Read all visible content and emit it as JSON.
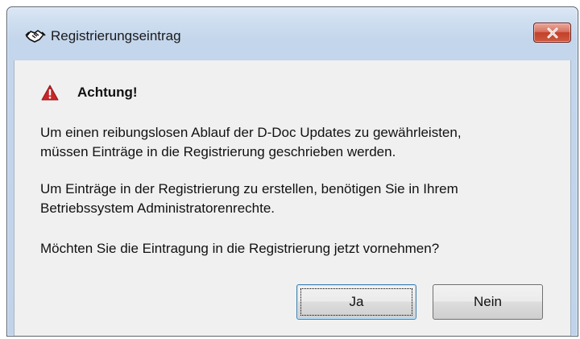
{
  "window": {
    "title": "Registrierungseintrag",
    "close_label": "✕"
  },
  "dialog": {
    "heading": "Achtung!",
    "paragraph1_line1": "Um einen reibungslosen Ablauf der D-Doc Updates zu gewährleisten,",
    "paragraph1_line2": "müssen Einträge in die Registrierung geschrieben werden.",
    "paragraph2_line1": "Um Einträge in der Registrierung zu erstellen, benötigen Sie in Ihrem",
    "paragraph2_line2": "Betriebssystem Administratorenrechte.",
    "question": "Möchten Sie die Eintragung in die Registrierung jetzt vornehmen?"
  },
  "buttons": {
    "yes_label": "Ja",
    "no_label": "Nein"
  },
  "icons": {
    "title_icon": "handshake-icon",
    "warning_icon": "warning-triangle-icon"
  },
  "colors": {
    "title_gradient": "#cfdff0",
    "client_bg": "#f0f0f0",
    "close_red": "#c3402a",
    "warning_red": "#c8262a"
  }
}
